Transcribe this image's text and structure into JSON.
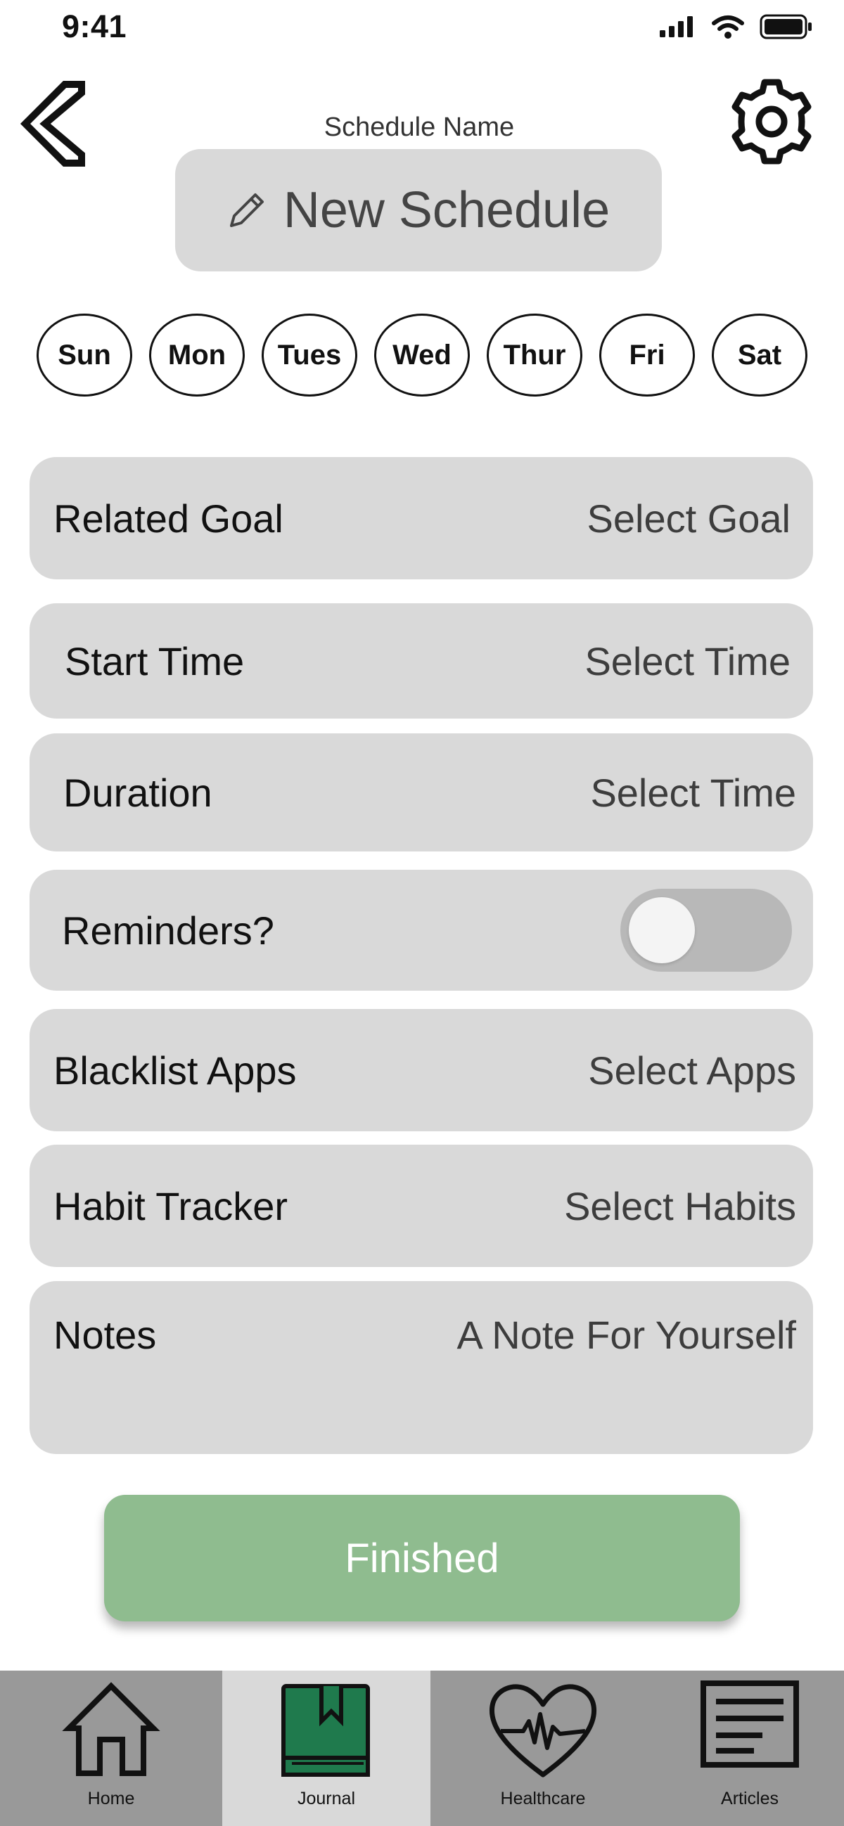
{
  "status_bar": {
    "time": "9:41"
  },
  "header": {
    "schedule_name_label": "Schedule Name",
    "schedule_name_value": "New Schedule"
  },
  "days": [
    "Sun",
    "Mon",
    "Tues",
    "Wed",
    "Thur",
    "Fri",
    "Sat"
  ],
  "fields": {
    "related_goal": {
      "label": "Related Goal",
      "value": "Select Goal"
    },
    "start_time": {
      "label": "Start Time",
      "value": "Select Time"
    },
    "duration": {
      "label": "Duration",
      "value": "Select Time"
    },
    "reminders": {
      "label": "Reminders?",
      "enabled": false
    },
    "blacklist_apps": {
      "label": "Blacklist Apps",
      "value": "Select Apps"
    },
    "habit_tracker": {
      "label": "Habit Tracker",
      "value": "Select Habits"
    },
    "notes": {
      "label": "Notes",
      "placeholder": "A Note For Yourself"
    }
  },
  "finished_button": {
    "label": "Finished"
  },
  "tabs": [
    {
      "label": "Home",
      "icon": "home-icon",
      "active": false
    },
    {
      "label": "Journal",
      "icon": "journal-icon",
      "active": true
    },
    {
      "label": "Healthcare",
      "icon": "heart-pulse-icon",
      "active": false
    },
    {
      "label": "Articles",
      "icon": "article-icon",
      "active": false
    }
  ],
  "colors": {
    "field_bg": "#d9d9d9",
    "finished_bg": "#8fbc8f",
    "tab_bg": "#999999",
    "tab_active_bg": "#d9d9d9",
    "journal_green": "#1f7a4d"
  }
}
